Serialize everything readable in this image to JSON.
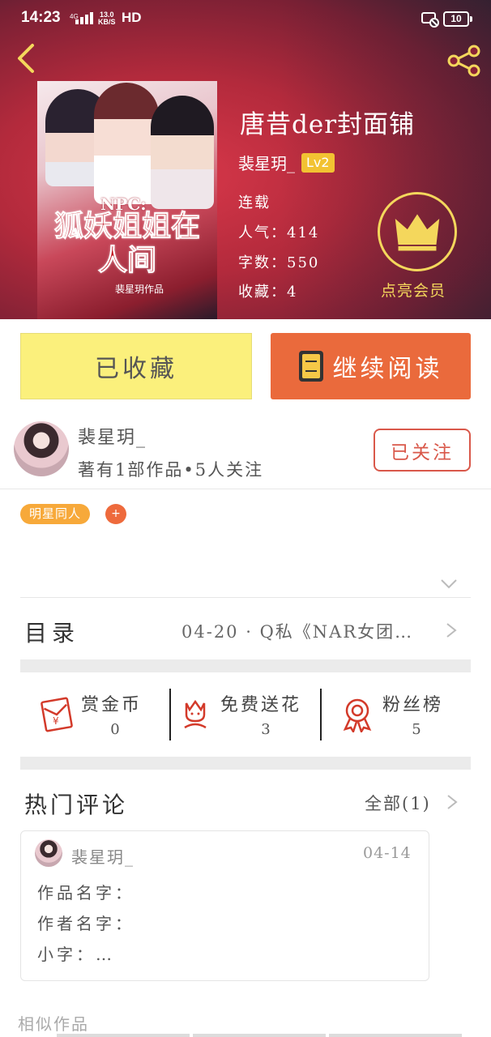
{
  "status_bar": {
    "time": "14:23",
    "network": "4G",
    "speed_value": "13.0",
    "speed_unit": "KB/S",
    "hd": "HD",
    "battery": "10"
  },
  "header": {
    "back_icon": "chevron-left-icon",
    "share_icon": "share-icon"
  },
  "cover": {
    "npc_text": "NPC:",
    "title_text": "狐妖姐姐在人间",
    "sub_text": "裴星玥作品"
  },
  "book": {
    "title": "唐昔der封面铺",
    "author": "裴星玥_",
    "level": "Lv2",
    "status": "连载",
    "popularity_label": "人气：414",
    "words_label": "字数：550",
    "collections_label": "收藏：4",
    "vip_label": "点亮会员"
  },
  "actions": {
    "collected_label": "已收藏",
    "continue_label": "继续阅读"
  },
  "author_card": {
    "name": "裴星玥_",
    "meta": "著有1部作品•5人关注",
    "follow_label": "已关注"
  },
  "tags": {
    "items": [
      "明星同人"
    ],
    "add_label": "+"
  },
  "toc": {
    "label": "目录",
    "latest": "04-20 · Q私《NAR女团…"
  },
  "stats": [
    {
      "label": "赏金币",
      "value": "0",
      "icon": "red-envelope-icon"
    },
    {
      "label": "免费送花",
      "value": "3",
      "icon": "flower-icon"
    },
    {
      "label": "粉丝榜",
      "value": "5",
      "icon": "ribbon-medal-icon"
    }
  ],
  "comments": {
    "title": "热门评论",
    "all_label": "全部(1)",
    "items": [
      {
        "user": "裴星玥_",
        "date": "04-14",
        "lines": [
          "作品名字：",
          "作者名字：",
          "小字：…"
        ]
      }
    ]
  },
  "similar": {
    "title": "相似作品"
  },
  "colors": {
    "accent_orange": "#ea6a3c",
    "collected_yellow": "#fbf07c",
    "vip_gold": "#f4d75c",
    "tag_orange": "#f7a93a",
    "follow_red": "#d9584a"
  }
}
